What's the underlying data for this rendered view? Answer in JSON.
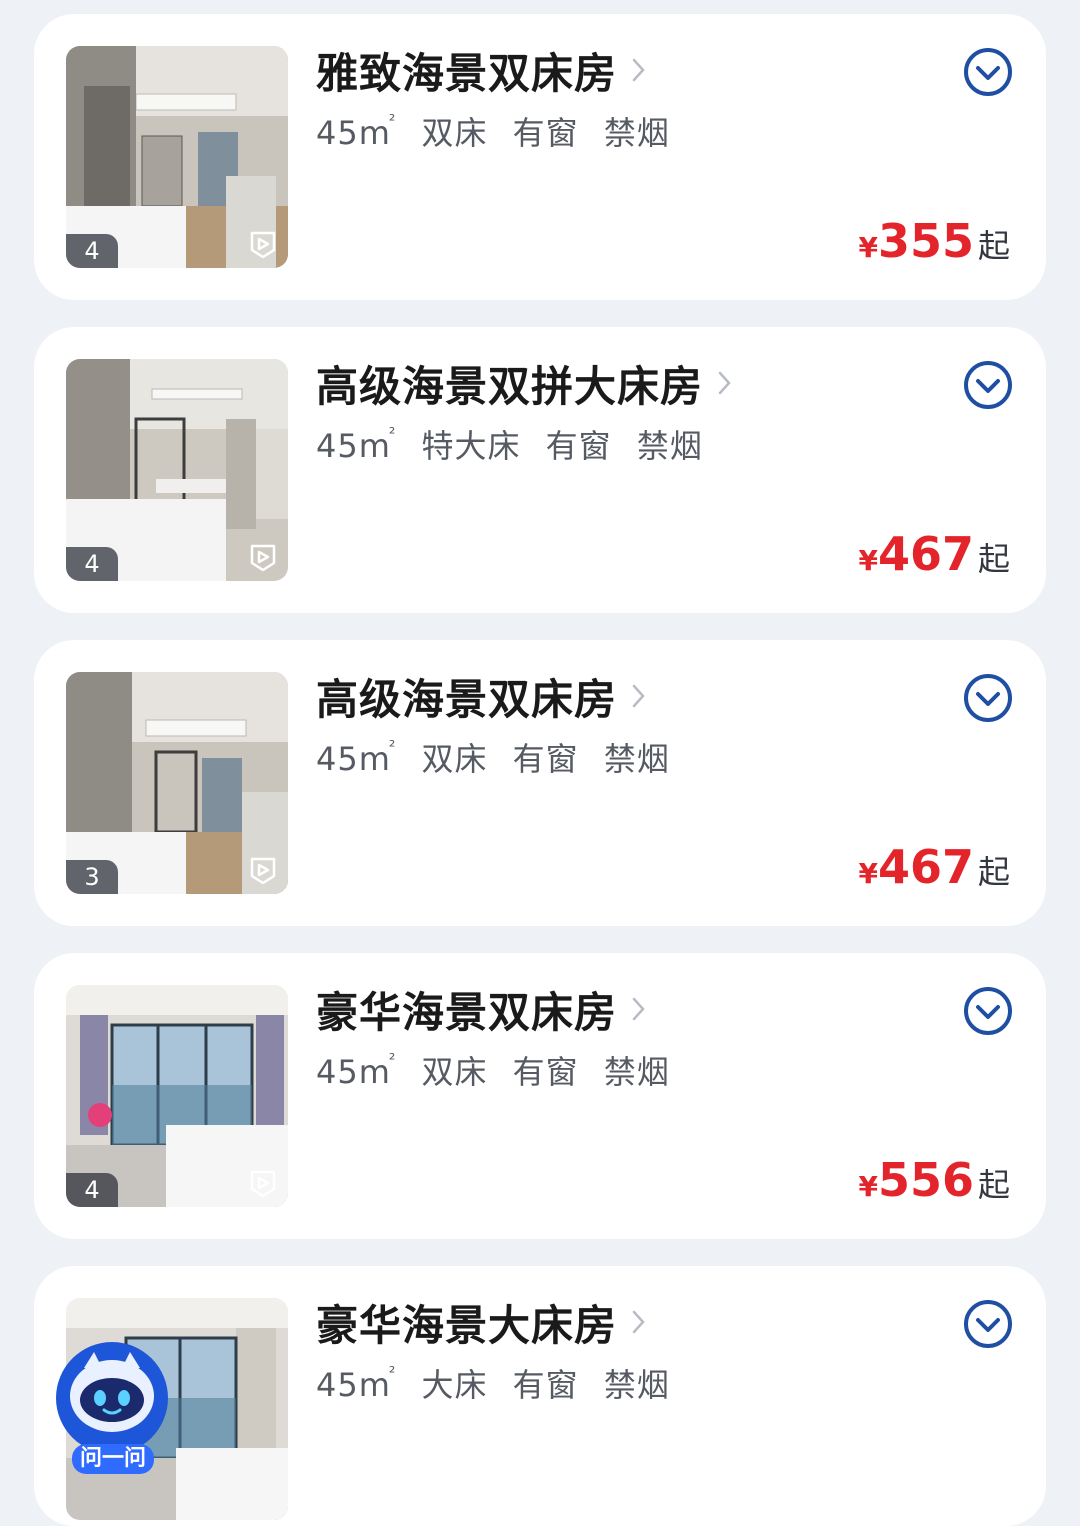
{
  "rooms": [
    {
      "title": "雅致海景双床房",
      "area_value": "45m",
      "area_sup": "²",
      "bed": "双床",
      "window": "有窗",
      "smoking": "禁烟",
      "currency": "¥",
      "price": "355",
      "price_suffix": "起",
      "photo_count": "4"
    },
    {
      "title": "高级海景双拼大床房",
      "area_value": "45m",
      "area_sup": "²",
      "bed": "特大床",
      "window": "有窗",
      "smoking": "禁烟",
      "currency": "¥",
      "price": "467",
      "price_suffix": "起",
      "photo_count": "4"
    },
    {
      "title": "高级海景双床房",
      "area_value": "45m",
      "area_sup": "²",
      "bed": "双床",
      "window": "有窗",
      "smoking": "禁烟",
      "currency": "¥",
      "price": "467",
      "price_suffix": "起",
      "photo_count": "3"
    },
    {
      "title": "豪华海景双床房",
      "area_value": "45m",
      "area_sup": "²",
      "bed": "双床",
      "window": "有窗",
      "smoking": "禁烟",
      "currency": "¥",
      "price": "556",
      "price_suffix": "起",
      "photo_count": "4"
    },
    {
      "title": "豪华海景大床房",
      "area_value": "45m",
      "area_sup": "²",
      "bed": "大床",
      "window": "有窗",
      "smoking": "禁烟"
    }
  ],
  "assistant": {
    "label": "问一问"
  },
  "icons": {
    "expand": "chevron-down-circle-icon",
    "title_arrow": "chevron-right-icon",
    "video": "video-play-icon",
    "assistant": "robot-assistant-icon"
  },
  "colors": {
    "price": "#e3242b",
    "accent": "#1f4fa3",
    "background": "#eef1f6"
  }
}
